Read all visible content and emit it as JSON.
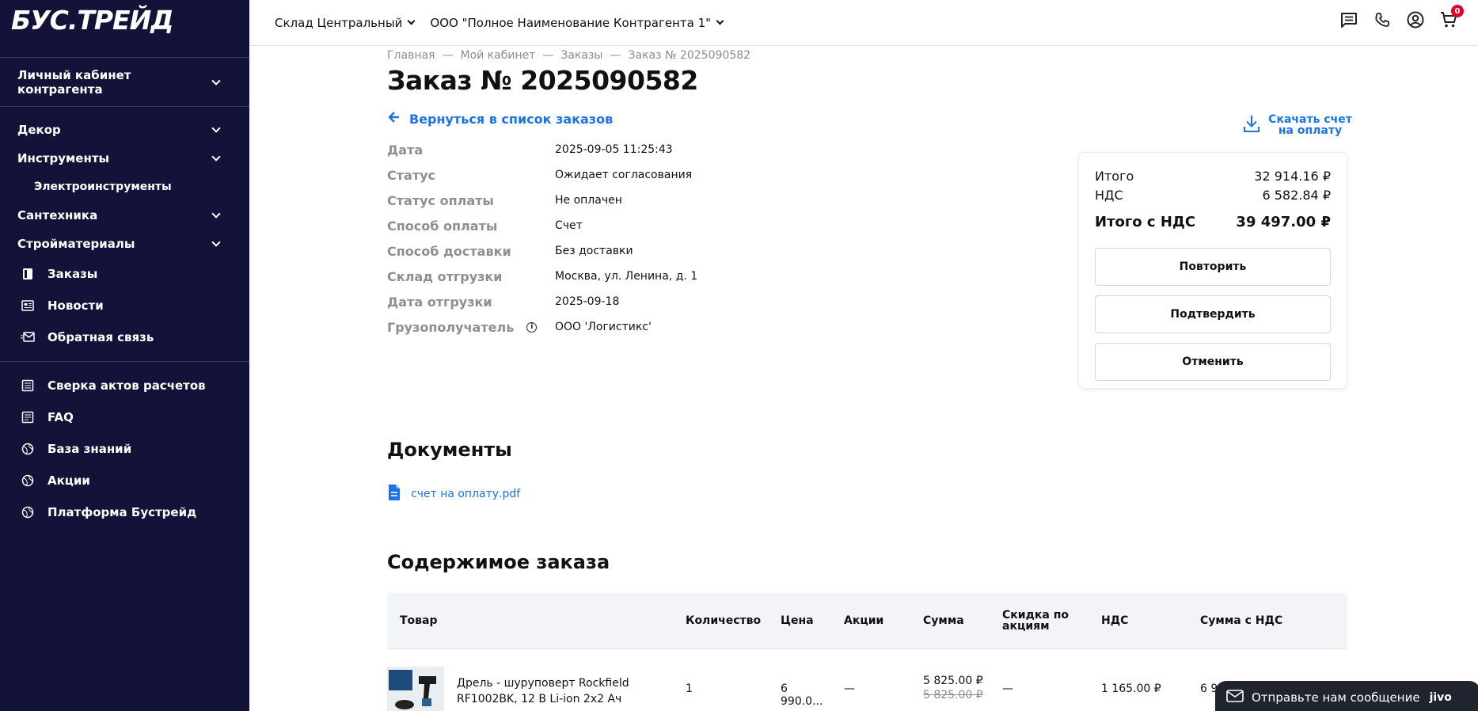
{
  "brand": {
    "logo": "БУС.ТРЕЙД"
  },
  "sidebar": {
    "cabinet_label": "Личный кабинет контрагента",
    "categories": [
      {
        "label": "Декор"
      },
      {
        "label": "Инструменты"
      },
      {
        "label": "Сантехника"
      },
      {
        "label": "Стройматериалы"
      }
    ],
    "subcategory": "Электроинструменты",
    "nav": [
      {
        "label": "Заказы",
        "icon": "orders-icon"
      },
      {
        "label": "Новости",
        "icon": "news-icon"
      },
      {
        "label": "Обратная связь",
        "icon": "feedback-icon"
      }
    ],
    "nav2": [
      {
        "label": "Сверка актов расчетов",
        "icon": "table-icon"
      },
      {
        "label": "FAQ",
        "icon": "faq-icon"
      },
      {
        "label": "База знаний",
        "icon": "globe-icon"
      },
      {
        "label": "Акции",
        "icon": "globe-icon"
      },
      {
        "label": "Платформа Бустрейд",
        "icon": "globe-icon"
      }
    ]
  },
  "header": {
    "warehouse": "Склад Центральный",
    "counterparty": "ООО \"Полное Наименование Контрагента 1\"",
    "cart_count": "0"
  },
  "breadcrumb": [
    "Главная",
    "Мой кабинет",
    "Заказы",
    "Заказ № 2025090582"
  ],
  "order": {
    "title": "Заказ № 2025090582",
    "back_label": "Вернуться в список заказов",
    "download_line1": "Скачать счет",
    "download_line2": "на оплату",
    "fields": [
      {
        "label": "Дата",
        "value": "2025-09-05 11:25:43"
      },
      {
        "label": "Статус",
        "value": "Ожидает согласования"
      },
      {
        "label": "Статус оплаты",
        "value": "Не оплачен"
      },
      {
        "label": "Способ оплаты",
        "value": "Счет"
      },
      {
        "label": "Способ доставки",
        "value": "Без доставки"
      },
      {
        "label": "Склад отгрузки",
        "value": "Москва, ул. Ленина, д. 1"
      },
      {
        "label": "Дата отгрузки",
        "value": "2025-09-18"
      },
      {
        "label": "Грузополучатель",
        "value": "ООО 'Логистикс'"
      }
    ]
  },
  "summary": {
    "total_label": "Итого",
    "total_value": "32 914.16 ₽",
    "vat_label": "НДС",
    "vat_value": "6 582.84 ₽",
    "grand_label": "Итого с НДС",
    "grand_value": "39 497.00 ₽",
    "repeat_label": "Повторить",
    "confirm_label": "Подтвердить",
    "cancel_label": "Отменить"
  },
  "documents": {
    "title": "Документы",
    "file": "счет на оплату.pdf"
  },
  "contents": {
    "title": "Содержимое заказа",
    "headers": {
      "product": "Товар",
      "qty": "Количество",
      "price": "Цена",
      "promo": "Акции",
      "sum": "Сумма",
      "discount_line1": "Скидка по",
      "discount_line2": "акциям",
      "vat": "НДС",
      "sum_vat": "Сумма с НДС"
    },
    "rows": [
      {
        "name_line1": "Дрель - шуруповерт Rockfield",
        "name_line2": "RF1002BK, 12 В Li-ion 2x2 Ач",
        "qty": "1",
        "price": "6 990.0...",
        "promo": "—",
        "sum": "5 825.00 ₽",
        "sum_old": "5 825.00 ₽",
        "discount": "—",
        "vat": "1 165.00 ₽",
        "sum_vat": "6 9"
      }
    ]
  },
  "chat": {
    "label": "Отправьте нам сообщение",
    "brand": "jivo"
  }
}
